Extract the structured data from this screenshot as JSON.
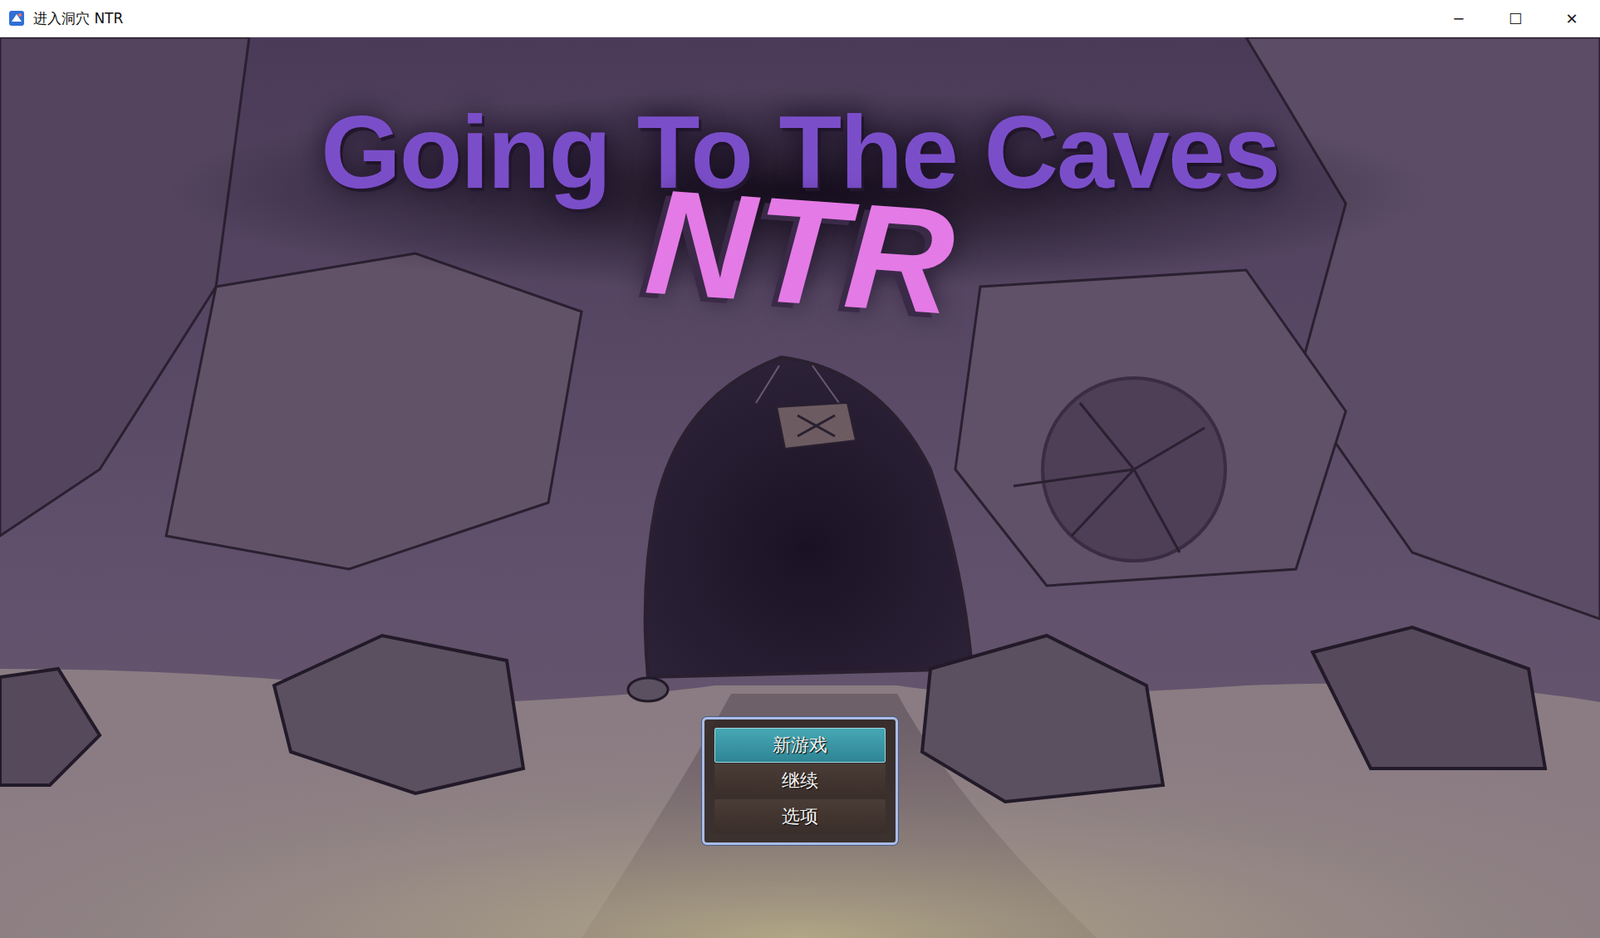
{
  "window": {
    "title": "进入洞穴 NTR",
    "controls": [
      "─",
      "☐",
      "✕"
    ]
  },
  "logo": {
    "title": "Going To The Caves",
    "subtitle": "NTR"
  },
  "menu": [
    {
      "label": "新游戏",
      "selected": true
    },
    {
      "label": "继续",
      "selected": false
    },
    {
      "label": "选项",
      "selected": false
    }
  ]
}
